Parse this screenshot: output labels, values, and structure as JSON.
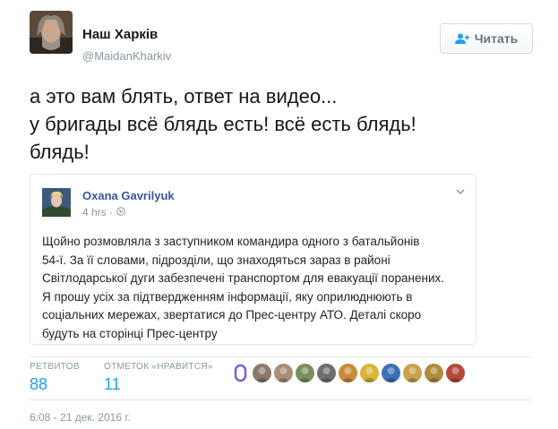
{
  "tweet": {
    "author_name": "Наш Харків",
    "author_handle": "@MaidanKharkiv",
    "follow_label": "Читать",
    "text_lines": [
      "а это вам блять, ответ на видео...",
      "у бригады всё блядь есть! всё есть блядь!",
      "блядь!"
    ]
  },
  "embedded_post": {
    "author": "Oxana Gavrilyuk",
    "time": "4 hrs ·",
    "body_lines": [
      "Щойно розмовляла з заступником командира одного з батальйонів",
      "54-ї. За її словами, підрозділи, що знаходяться зараз в районі",
      "Світлодарської дуги забезпечені транспортом для евакуації поранених.",
      "Я прошу усіх за підтвердженням інформації, яку оприлюднюють в",
      "соціальних мережах, звертатися до Прес-центру АТО. Деталі скоро",
      "будуть на сторінці Прес-центру"
    ]
  },
  "stats": {
    "retweets_label": "РЕТВИТОВ",
    "retweets_value": "88",
    "likes_label": "ОТМЕТОК «НРАВИТСЯ»",
    "likes_value": "11"
  },
  "likers": [
    {
      "icon": "liker-avatar",
      "color": "#7b5fd6"
    },
    {
      "icon": "liker-avatar",
      "color": "#8a7a6a"
    },
    {
      "icon": "liker-avatar",
      "color": "#a88f78"
    },
    {
      "icon": "liker-avatar",
      "color": "#7a8f5c"
    },
    {
      "icon": "liker-avatar",
      "color": "#6e6e6e"
    },
    {
      "icon": "liker-avatar",
      "color": "#c98b3a"
    },
    {
      "icon": "liker-avatar",
      "color": "#d9b53a"
    },
    {
      "icon": "liker-avatar",
      "color": "#3f6fb5"
    },
    {
      "icon": "liker-avatar",
      "color": "#c9a24a"
    },
    {
      "icon": "liker-avatar",
      "color": "#b08a3e"
    },
    {
      "icon": "liker-avatar",
      "color": "#b54a3a"
    }
  ],
  "timestamp": "6:08 - 21 дек. 2016 г.",
  "colors": {
    "accent": "#1da1f2",
    "muted": "#8899a6",
    "fb_link": "#365899"
  }
}
